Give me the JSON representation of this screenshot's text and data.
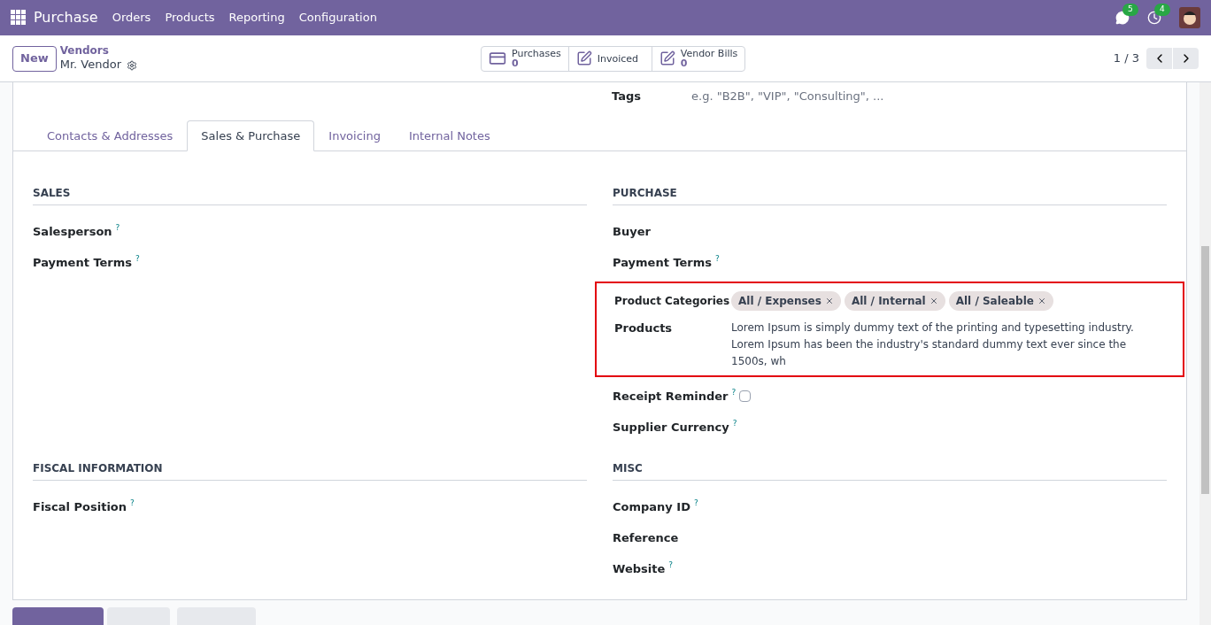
{
  "navbar": {
    "app": "Purchase",
    "menu": [
      "Orders",
      "Products",
      "Reporting",
      "Configuration"
    ],
    "messages_badge": "5",
    "activities_badge": "4"
  },
  "control_panel": {
    "new_button": "New",
    "breadcrumb": "Vendors",
    "record": "Mr. Vendor",
    "pager": "1 / 3",
    "smart_buttons": [
      {
        "kind": "card",
        "label": "Purchases",
        "value": "0"
      },
      {
        "kind": "edit",
        "label": "Invoiced"
      },
      {
        "kind": "edit",
        "label": "Vendor Bills",
        "value": "0"
      }
    ]
  },
  "tags_field": {
    "label": "Tags",
    "placeholder": "e.g. \"B2B\", \"VIP\", \"Consulting\", ..."
  },
  "tabs": [
    {
      "label": "Contacts & Addresses",
      "selected": false
    },
    {
      "label": "Sales & Purchase",
      "selected": true
    },
    {
      "label": "Invoicing",
      "selected": false
    },
    {
      "label": "Internal Notes",
      "selected": false
    }
  ],
  "sections": [
    {
      "title": "SALES",
      "fields": [
        {
          "label": "Salesperson",
          "help": "?"
        },
        {
          "label": "Payment Terms",
          "help": "?"
        }
      ]
    },
    {
      "title": "PURCHASE",
      "fields": [
        {
          "label": "Buyer"
        },
        {
          "label": "Payment Terms",
          "help": "?"
        }
      ],
      "highlight": {
        "categories_label": "Product Categories",
        "categories": [
          "All / Expenses",
          "All / Internal",
          "All / Saleable"
        ],
        "products_label": "Products",
        "products_text": "Lorem Ipsum is simply dummy text of the printing and typesetting industry. Lorem Ipsum has been the industry's standard dummy text ever since the 1500s, wh"
      },
      "more_fields": [
        {
          "label": "Receipt Reminder",
          "help": "?",
          "kind": "checkbox",
          "checked": false
        },
        {
          "label": "Supplier Currency",
          "help": "?",
          "kind": "text"
        }
      ]
    },
    {
      "title": "FISCAL INFORMATION",
      "fields": [
        {
          "label": "Fiscal Position",
          "help": "?"
        }
      ]
    },
    {
      "title": "MISC",
      "fields": [
        {
          "label": "Company ID",
          "help": "?"
        },
        {
          "label": "Reference"
        },
        {
          "label": "Website",
          "help": "?"
        }
      ]
    }
  ]
}
